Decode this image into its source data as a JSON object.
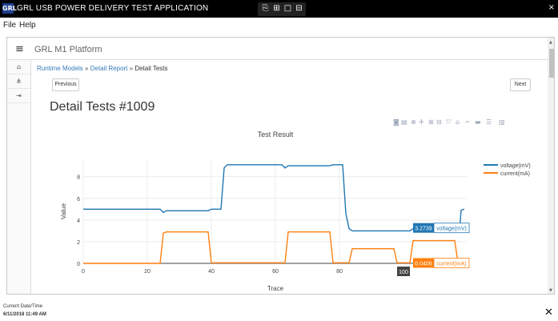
{
  "window": {
    "logo_text": "GRL",
    "title": "GRL USB POWER DELIVERY TEST APPLICATION",
    "close_glyph": "×",
    "tools": [
      "⎘",
      "⊞",
      "□",
      "⊟"
    ]
  },
  "menu": {
    "items": [
      "File",
      "Help"
    ]
  },
  "page": {
    "platform_title": "GRL M1 Platform",
    "hamburger_glyph": "≡",
    "breadcrumb": {
      "items": [
        "Runtime Models",
        "Detail Report"
      ],
      "separator": " » ",
      "current": "Detail Tests"
    },
    "previous_label": "Previous",
    "next_label": "Next",
    "title": "Detail Tests #1009",
    "sidebar_icons": [
      "home-icon",
      "sitemap-icon",
      "sign-out-icon"
    ],
    "sidebar_glyphs": [
      "⌂",
      "⋔",
      "⇥"
    ]
  },
  "modebar": {
    "icons": [
      "camera-icon",
      "save-icon",
      "zoom-icon",
      "pan-icon",
      "zoom-in-icon",
      "zoom-out-icon",
      "autoscale-icon",
      "reset-axes-icon",
      "spike-lines-icon",
      "hover-closest-icon",
      "hover-compare-icon",
      "plotly-logo-icon"
    ],
    "glyphs": [
      "◙",
      "▤",
      "⊕",
      "✛",
      "⊞",
      "⊟",
      "⤧",
      "⌂",
      "⌐",
      "▬",
      "☰",
      "▥"
    ]
  },
  "chart_data": {
    "type": "line",
    "title": "Test Result",
    "xlabel": "Trace",
    "ylabel": "Value",
    "xlim": [
      0,
      120
    ],
    "ylim": [
      0,
      9.6
    ],
    "xticks": [
      0,
      20,
      40,
      60,
      80
    ],
    "yticks": [
      0,
      2,
      4,
      6,
      8
    ],
    "grid": true,
    "legend_position": "top-right",
    "series": [
      {
        "name": "voltage(mV)",
        "color": "#1f77b4",
        "points": [
          [
            0,
            5.0
          ],
          [
            24,
            5.0
          ],
          [
            25,
            4.7
          ],
          [
            26,
            4.85
          ],
          [
            39,
            4.85
          ],
          [
            40,
            5.0
          ],
          [
            43,
            5.0
          ],
          [
            44,
            8.8
          ],
          [
            45,
            9.1
          ],
          [
            62,
            9.1
          ],
          [
            63,
            8.8
          ],
          [
            64,
            9.0
          ],
          [
            77,
            9.0
          ],
          [
            78,
            9.1
          ],
          [
            81,
            9.1
          ],
          [
            82,
            4.6
          ],
          [
            83,
            3.2
          ],
          [
            84,
            3.0
          ],
          [
            102,
            3.0
          ],
          [
            103,
            3.2
          ],
          [
            116,
            3.2
          ],
          [
            117,
            3.0
          ],
          [
            117.5,
            3.0
          ],
          [
            118,
            4.9
          ],
          [
            119,
            5.0
          ]
        ]
      },
      {
        "name": "current(mA)",
        "color": "#ff7f0e",
        "points": [
          [
            0,
            0.0
          ],
          [
            24,
            0.0
          ],
          [
            25,
            2.8
          ],
          [
            26,
            2.9
          ],
          [
            39,
            2.9
          ],
          [
            40,
            0.05
          ],
          [
            63,
            0.05
          ],
          [
            64,
            2.9
          ],
          [
            77,
            2.9
          ],
          [
            78,
            0.05
          ],
          [
            83,
            0.05
          ],
          [
            84,
            1.35
          ],
          [
            97,
            1.35
          ],
          [
            98,
            0.05
          ],
          [
            102,
            0.05
          ],
          [
            103,
            2.1
          ],
          [
            116,
            2.1
          ],
          [
            117,
            0.08
          ],
          [
            119,
            0.08
          ]
        ]
      }
    ],
    "hover": {
      "x_label": "100",
      "items": [
        {
          "value": "3.2739",
          "series": "voltage(mV)",
          "y": 3.27
        },
        {
          "value": "0.0406",
          "series": "current(mA)",
          "y": 0.04
        }
      ]
    }
  },
  "footer": {
    "label": "Current Date/Time",
    "datetime": "6/11/2018 11:49 AM",
    "close_glyph": "✕"
  }
}
